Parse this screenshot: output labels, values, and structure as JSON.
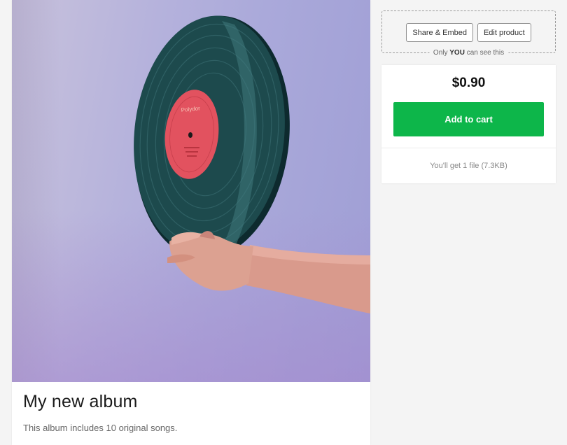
{
  "product": {
    "title": "My new album",
    "description": "This album includes 10 original songs.",
    "record_label_text": "Polydor"
  },
  "owner_tools": {
    "share_label": "Share & Embed",
    "edit_label": "Edit product",
    "visibility_prefix": "Only",
    "visibility_emphasis": "YOU",
    "visibility_suffix": "can see this"
  },
  "purchase": {
    "price": "$0.90",
    "add_to_cart_label": "Add to cart",
    "file_info": "You'll get 1 file (7.3KB)"
  },
  "colors": {
    "accent_green": "#0db64a",
    "background": "#f4f4f4",
    "record_label": "#e2525f"
  }
}
